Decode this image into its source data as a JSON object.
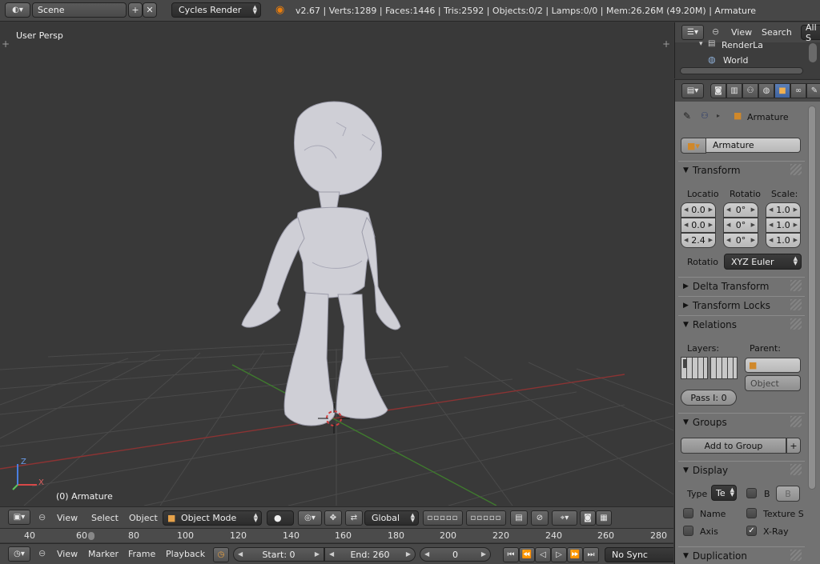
{
  "topbar": {
    "scene_label": "Scene",
    "render_engine": "Cycles Render",
    "stats": "v2.67 | Verts:1289 | Faces:1446 | Tris:2592 | Objects:0/2 | Lamps:0/0 | Mem:26.26M (49.20M) | Armature"
  },
  "viewport": {
    "view_label": "User Persp",
    "object_label": "(0) Armature",
    "axis_x": "X",
    "axis_z": "Z"
  },
  "view3d_header": {
    "menus": [
      "View",
      "Select",
      "Object"
    ],
    "mode": "Object Mode",
    "orientation": "Global"
  },
  "timeline": {
    "ruler_ticks": [
      "40",
      "60",
      "80",
      "100",
      "120",
      "140",
      "160",
      "180",
      "200",
      "220",
      "240",
      "260",
      "280"
    ],
    "menus": [
      "View",
      "Marker",
      "Frame",
      "Playback"
    ],
    "start_field": "Start: 0",
    "end_field": "End: 260",
    "current_frame": "0",
    "sync": "No Sync"
  },
  "outliner": {
    "menus": [
      "View",
      "Search"
    ],
    "filter": "All S",
    "items": [
      "RenderLa",
      "World"
    ]
  },
  "properties": {
    "breadcrumb": "Armature",
    "object_name": "Armature",
    "transform": {
      "title": "Transform",
      "location_label": "Locatio",
      "rotation_label": "Rotatio",
      "scale_label": "Scale:",
      "location": [
        "0.0",
        "0.0",
        "2.4"
      ],
      "rotation": [
        "0°",
        "0°",
        "0°"
      ],
      "scale": [
        "1.0",
        "1.0",
        "1.0"
      ],
      "rotation_mode_label": "Rotatio",
      "rotation_mode": "XYZ Euler"
    },
    "delta_transform": "Delta Transform",
    "transform_locks": "Transform Locks",
    "relations": {
      "title": "Relations",
      "layers_label": "Layers:",
      "parent_label": "Parent:",
      "parent_type": "Object",
      "pass_index": "Pass I: 0"
    },
    "groups": {
      "title": "Groups",
      "add_button": "Add to Group"
    },
    "display": {
      "title": "Display",
      "type_label": "Type",
      "type_value": "Te",
      "b_label": "B",
      "b_value": "B",
      "name_label": "Name",
      "texture_label": "Texture S",
      "axis_label": "Axis",
      "xray_label": "X-Ray",
      "xray_checked": true
    },
    "duplication": "Duplication"
  },
  "colors": {
    "viewport_bg": "#393939",
    "panel_bg": "#727272",
    "active_tab": "#4f72ad",
    "x_axis": "#9a3030",
    "y_axis": "#3a7a2a"
  }
}
